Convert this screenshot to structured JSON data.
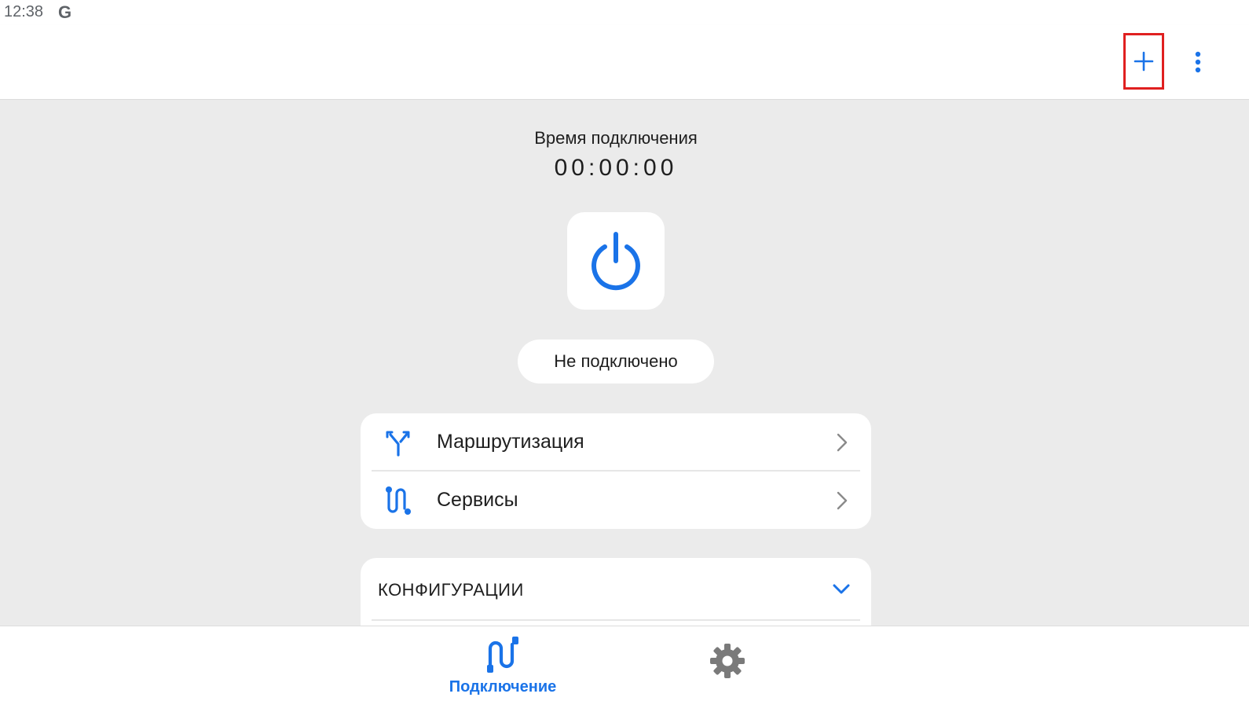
{
  "status_bar": {
    "time": "12:38",
    "google_letter": "G"
  },
  "app_bar": {
    "add_icon": "plus-icon",
    "more_icon": "more-vert-icon"
  },
  "connection": {
    "time_label": "Время подключения",
    "timer": "00:00:00",
    "power_icon": "power-icon",
    "status": "Не подключено"
  },
  "menu": {
    "items": [
      {
        "label": "Маршрутизация",
        "icon": "routing-icon"
      },
      {
        "label": "Сервисы",
        "icon": "services-icon"
      }
    ]
  },
  "configs": {
    "title": "КОНФИГУРАЦИИ",
    "expanded_icon": "chevron-down-icon"
  },
  "bottom_nav": {
    "tabs": [
      {
        "label": "Подключение",
        "icon": "connection-icon",
        "active": true
      },
      {
        "label": "",
        "icon": "gear-icon",
        "active": false
      }
    ]
  },
  "colors": {
    "accent": "#1a73e8",
    "background": "#ebebeb",
    "highlight": "#e02020"
  }
}
